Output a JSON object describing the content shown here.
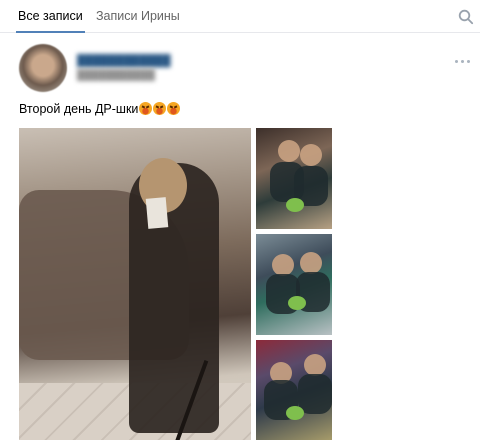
{
  "tabs": [
    {
      "label": "Все записи",
      "active": true
    },
    {
      "label": "Записи Ирины",
      "active": false
    }
  ],
  "post": {
    "text": "Второй день ДР-шки",
    "emoji": [
      "tired-face-emoji",
      "tired-face-emoji",
      "tired-face-emoji"
    ]
  },
  "colors": {
    "accent": "#5181b8",
    "link": "#2a5885",
    "muted": "#939393",
    "divider": "#e7e8ec"
  },
  "icons": {
    "search": "search-icon",
    "more": "more-dots-icon"
  }
}
